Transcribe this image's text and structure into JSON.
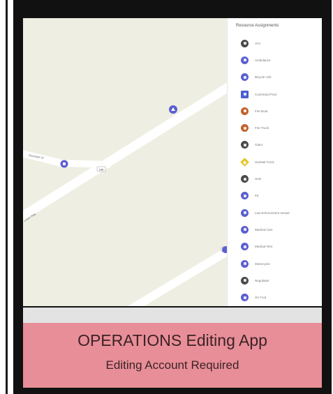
{
  "sidebar": {
    "title": "Resource Assignments",
    "items": [
      {
        "label": "ATV",
        "icon": "atv-icon",
        "color": "#4a4a4a",
        "shape": "circle"
      },
      {
        "label": "Ambulance",
        "icon": "ambulance-icon",
        "color": "#5b5fd0",
        "shape": "circle"
      },
      {
        "label": "Bicycle Unit",
        "icon": "bicycle-icon",
        "color": "#5b5fd0",
        "shape": "circle"
      },
      {
        "label": "Command Post",
        "icon": "command-post-icon",
        "color": "#4a5fd0",
        "shape": "square"
      },
      {
        "label": "Fire Boat",
        "icon": "fire-boat-icon",
        "color": "#c2612a",
        "shape": "circle"
      },
      {
        "label": "Fire Truck",
        "icon": "fire-truck-icon",
        "color": "#c2612a",
        "shape": "circle"
      },
      {
        "label": "Gator",
        "icon": "gator-icon",
        "color": "#4a4a4a",
        "shape": "circle"
      },
      {
        "label": "HazMat Truck",
        "icon": "hazmat-icon",
        "color": "#e3c629",
        "shape": "diamond"
      },
      {
        "label": "Helo",
        "icon": "helicopter-icon",
        "color": "#4a4a4a",
        "shape": "circle"
      },
      {
        "label": "K9",
        "icon": "k9-icon",
        "color": "#5b5fd0",
        "shape": "circle"
      },
      {
        "label": "Law Enforcement Vessel",
        "icon": "law-vessel-icon",
        "color": "#5b5fd0",
        "shape": "circle"
      },
      {
        "label": "Medical Cart",
        "icon": "medical-cart-icon",
        "color": "#5b5fd0",
        "shape": "circle"
      },
      {
        "label": "Medical Tent",
        "icon": "medical-tent-icon",
        "color": "#5b5fd0",
        "shape": "circle"
      },
      {
        "label": "Motorcycle",
        "icon": "motorcycle-icon",
        "color": "#5b5fd0",
        "shape": "circle"
      },
      {
        "label": "Negotiator",
        "icon": "negotiator-icon",
        "color": "#4a4a4a",
        "shape": "circle"
      },
      {
        "label": "On Foot",
        "icon": "on-foot-icon",
        "color": "#5b5fd0",
        "shape": "circle"
      }
    ]
  },
  "map": {
    "road_labels": [
      "Riverside Dr",
      "Lower Way"
    ],
    "route_shields": [
      "186",
      "186"
    ],
    "marker_icons": [
      "ambulance-marker-icon",
      "unit-marker-icon",
      "unit-marker-icon"
    ]
  },
  "banner": {
    "title": "OPERATIONS Editing App",
    "subtitle": "Editing Account Required",
    "background": "#e88e98"
  }
}
